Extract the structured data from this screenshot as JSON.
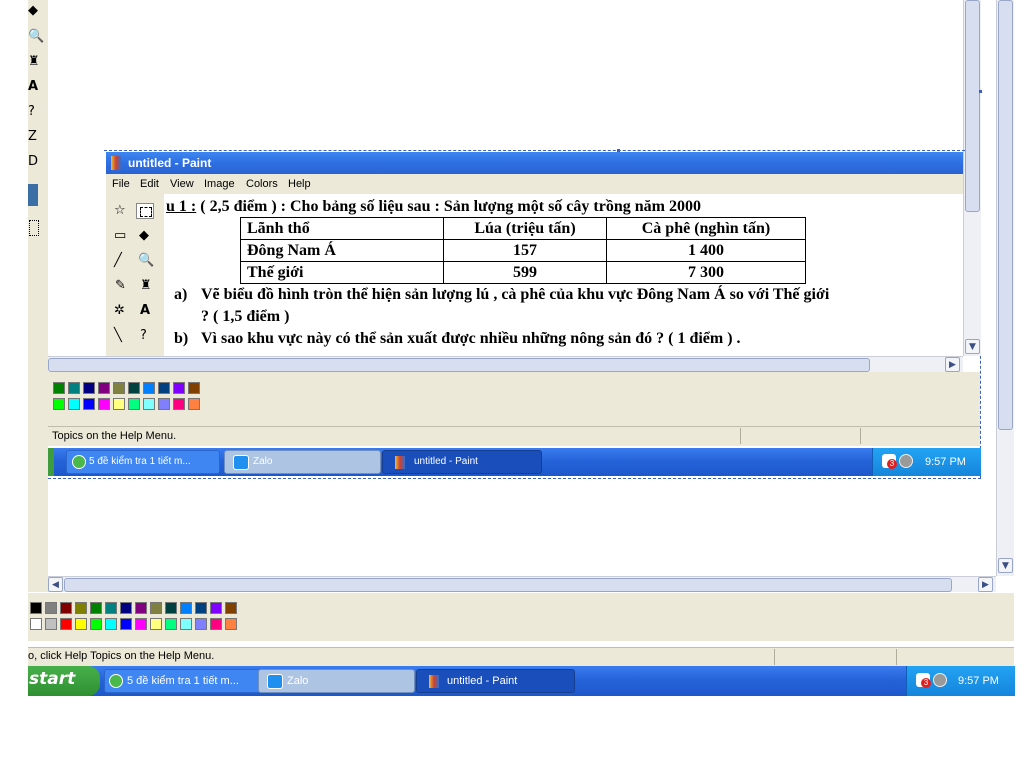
{
  "outer": {
    "status_text": "o, click Help Topics on the Help Menu.",
    "start_label": "start",
    "taskbar": [
      {
        "label": "5 đề kiểm tra 1 tiết m..."
      },
      {
        "label": "Zalo"
      },
      {
        "label": "untitled - Paint"
      }
    ],
    "tray_badge": "3",
    "clock": "9:57 PM"
  },
  "inner": {
    "title": "untitled - Paint",
    "menu": [
      "File",
      "Edit",
      "View",
      "Image",
      "Colors",
      "Help"
    ],
    "status_text": "Topics on the Help Menu.",
    "taskbar": [
      {
        "label": "5 đề kiểm tra 1 tiết m..."
      },
      {
        "label": "Zalo"
      },
      {
        "label": "untitled - Paint"
      }
    ],
    "tray_badge": "3",
    "clock": "9:57 PM"
  },
  "document": {
    "heading_prefix": "u 1 :",
    "heading_rest": " ( 2,5 điểm )  : Cho bảng số liệu sau : Sản lượng một số cây trồng năm 2000",
    "table": {
      "headers": [
        "Lãnh thổ",
        "Lúa (triệu tấn)",
        "Cà phê (nghìn tấn)"
      ],
      "rows": [
        [
          "Đông Nam Á",
          "157",
          "1 400"
        ],
        [
          "Thế giới",
          "599",
          "7 300"
        ]
      ]
    },
    "question_a_marker": "a)",
    "question_a_line1": "Vẽ biểu đồ hình tròn thể hiện sản lượng lú , cà phê của khu vực Đông Nam Á so với Thế  giới",
    "question_a_line2": "? ( 1,5 điểm )",
    "question_b_marker": "b)",
    "question_b_text": "Vì sao khu vực này có thể sản xuất được nhiều những nông sản đó ? ( 1 điểm ) ."
  },
  "palette_outer_row1": [
    "#000000",
    "#808080",
    "#800000",
    "#808000",
    "#008000",
    "#008080",
    "#000080",
    "#800080",
    "#808040",
    "#004040",
    "#0080ff",
    "#004080",
    "#8000ff",
    "#804000"
  ],
  "palette_outer_row2": [
    "#ffffff",
    "#c0c0c0",
    "#ff0000",
    "#ffff00",
    "#00ff00",
    "#00ffff",
    "#0000ff",
    "#ff00ff",
    "#ffff80",
    "#00ff80",
    "#80ffff",
    "#8080ff",
    "#ff0080",
    "#ff8040"
  ],
  "palette_inner_row1": [
    "#008000",
    "#008080",
    "#000080",
    "#800080",
    "#808040",
    "#004040",
    "#0080ff",
    "#004080",
    "#8000ff",
    "#804000"
  ],
  "palette_inner_row2": [
    "#00ff00",
    "#00ffff",
    "#0000ff",
    "#ff00ff",
    "#ffff80",
    "#00ff80",
    "#80ffff",
    "#8080ff",
    "#ff0080",
    "#ff8040"
  ],
  "colors": {
    "xp_blue": "#2563d9",
    "tray_blue": "#1585dc",
    "title_bar": "#2e6fe3"
  }
}
